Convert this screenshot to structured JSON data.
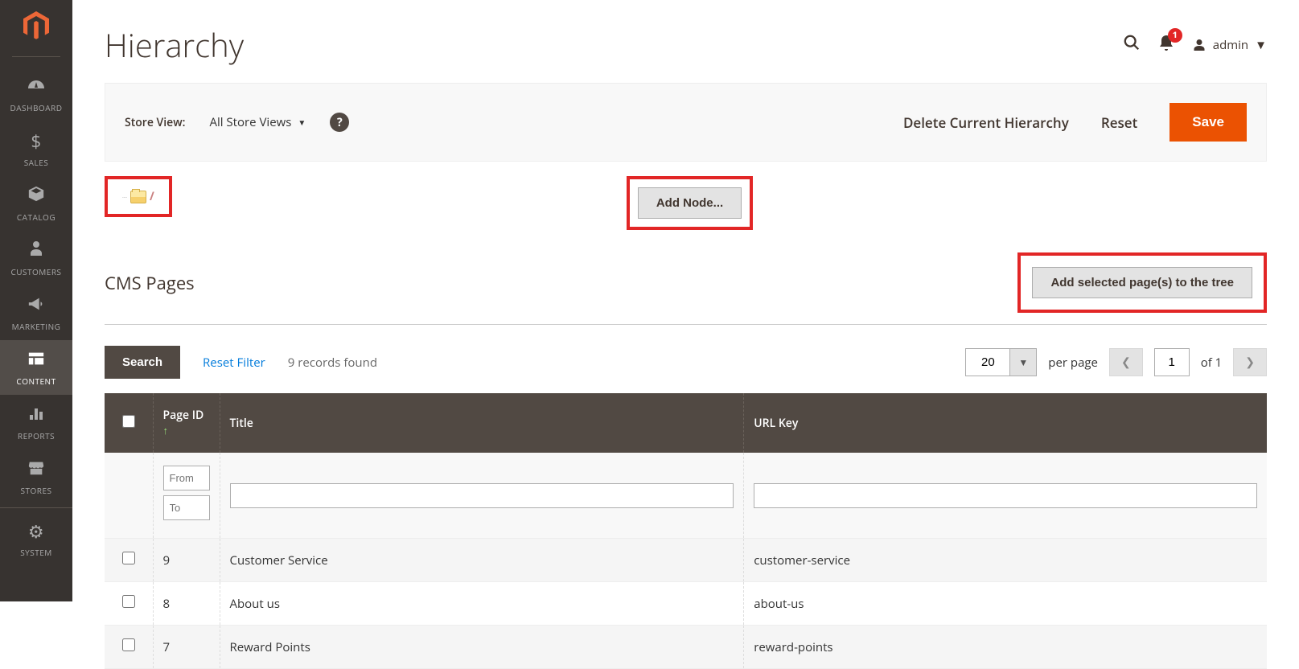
{
  "sidebar": {
    "items": [
      {
        "label": "DASHBOARD",
        "icon": "dashboard"
      },
      {
        "label": "SALES",
        "icon": "dollar"
      },
      {
        "label": "CATALOG",
        "icon": "box"
      },
      {
        "label": "CUSTOMERS",
        "icon": "person"
      },
      {
        "label": "MARKETING",
        "icon": "megaphone"
      },
      {
        "label": "CONTENT",
        "icon": "layout"
      },
      {
        "label": "REPORTS",
        "icon": "bars"
      },
      {
        "label": "STORES",
        "icon": "store"
      },
      {
        "label": "SYSTEM",
        "icon": "gear"
      }
    ]
  },
  "header": {
    "page_title": "Hierarchy",
    "notification_count": "1",
    "admin_label": "admin"
  },
  "toolbar": {
    "store_view_label": "Store View:",
    "store_view_value": "All Store Views",
    "delete_label": "Delete Current Hierarchy",
    "reset_label": "Reset",
    "save_label": "Save"
  },
  "tree": {
    "root_slash": "/",
    "add_node_label": "Add Node..."
  },
  "cms": {
    "section_title": "CMS Pages",
    "add_selected_label": "Add selected page(s) to the tree"
  },
  "filters": {
    "search_label": "Search",
    "reset_filter_label": "Reset Filter",
    "records_found": "9 records found",
    "per_page_value": "20",
    "per_page_label": "per page",
    "current_page": "1",
    "total_pages": "of 1",
    "from_placeholder": "From",
    "to_placeholder": "To"
  },
  "grid": {
    "columns": {
      "page_id": "Page ID",
      "title": "Title",
      "url_key": "URL Key"
    },
    "rows": [
      {
        "id": "9",
        "title": "Customer Service",
        "url_key": "customer-service"
      },
      {
        "id": "8",
        "title": "About us",
        "url_key": "about-us"
      },
      {
        "id": "7",
        "title": "Reward Points",
        "url_key": "reward-points"
      }
    ]
  }
}
